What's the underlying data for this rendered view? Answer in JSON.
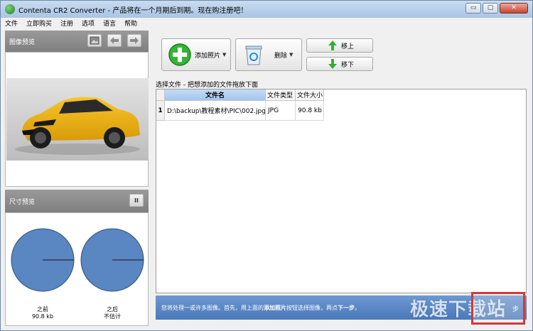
{
  "window": {
    "title": "Contenta CR2 Converter  - 产品将在一个月期后到期。现在购注册吧！",
    "buttons": {
      "minimize": "▭",
      "restore": "▢",
      "close": "✕"
    }
  },
  "menu": [
    "文件",
    "立即购买",
    "注册",
    "选项",
    "语言",
    "帮助"
  ],
  "image_preview": {
    "title": "图像预览",
    "icons": [
      "image-icon",
      "arrow-left-icon",
      "arrow-right-icon"
    ]
  },
  "size_preview": {
    "title": "尺寸预览",
    "pause_label": "II",
    "before": {
      "label": "之前",
      "value": "90.8 kb"
    },
    "after": {
      "label": "之后",
      "value": "不估计"
    },
    "pie_color": "#5a86c2"
  },
  "toolbar": {
    "add_label": "添加照片",
    "delete_label": "删除",
    "move_up_label": "移上",
    "move_down_label": "移下"
  },
  "hint": "选择文件 - 把想添加的文件拖放下面",
  "file_table": {
    "columns": [
      "文件名",
      "文件类型",
      "文件大小"
    ],
    "rows": [
      {
        "num": "1",
        "name": "D:\\backup\\教程素材\\PIC\\002.jpg",
        "type": "JPG",
        "size": "90.8 kb"
      }
    ]
  },
  "status": {
    "text_before": "您将处理一或许多图像。首先，用上面的",
    "text_bold": "添加照片",
    "text_after": "按钮选择图像，再点",
    "text_bold2": "下一步",
    "text_end": "。"
  },
  "next_button": {
    "label": "步"
  },
  "watermark": "极速下载站",
  "colors": {
    "accent": "#4b78b8",
    "close": "#c6452f",
    "highlight_border": "#d23a3a"
  }
}
